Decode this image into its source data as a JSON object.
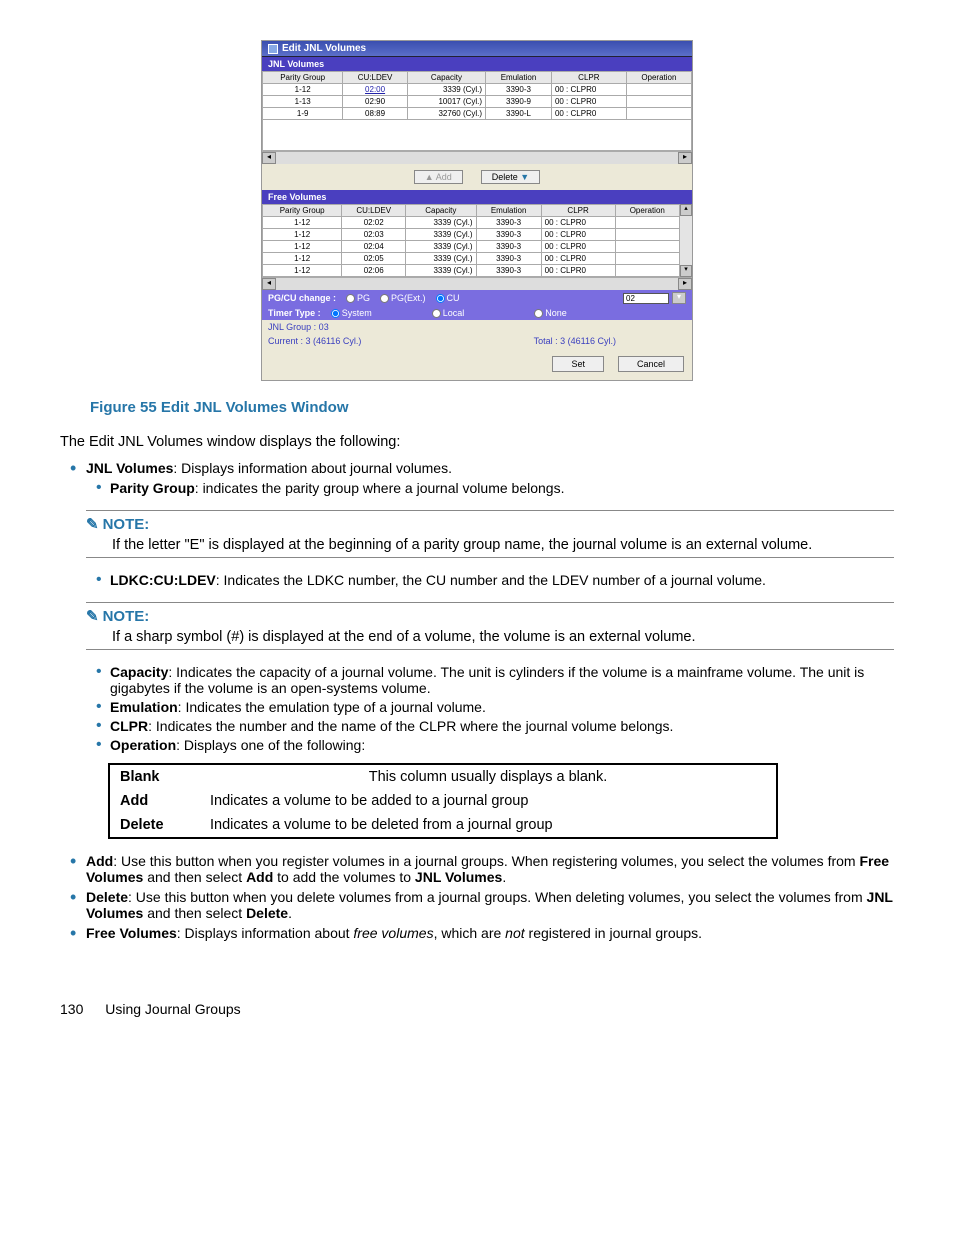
{
  "window": {
    "title": "Edit JNL Volumes",
    "jnl_section": "JNL Volumes",
    "free_section": "Free Volumes",
    "headers": [
      "Parity Group",
      "CU:LDEV",
      "Capacity",
      "Emulation",
      "CLPR",
      "Operation"
    ],
    "jnl_rows": [
      {
        "pg": "1-12",
        "cl": "02:00",
        "cap": "3339 (Cyl.)",
        "emu": "3390-3",
        "clpr": "00 : CLPR0",
        "op": ""
      },
      {
        "pg": "1-13",
        "cl": "02:90",
        "cap": "10017 (Cyl.)",
        "emu": "3390-9",
        "clpr": "00 : CLPR0",
        "op": ""
      },
      {
        "pg": "1-9",
        "cl": "08:89",
        "cap": "32760 (Cyl.)",
        "emu": "3390-L",
        "clpr": "00 : CLPR0",
        "op": ""
      }
    ],
    "free_rows": [
      {
        "pg": "1-12",
        "cl": "02:02",
        "cap": "3339 (Cyl.)",
        "emu": "3390-3",
        "clpr": "00 : CLPR0",
        "op": ""
      },
      {
        "pg": "1-12",
        "cl": "02:03",
        "cap": "3339 (Cyl.)",
        "emu": "3390-3",
        "clpr": "00 : CLPR0",
        "op": ""
      },
      {
        "pg": "1-12",
        "cl": "02:04",
        "cap": "3339 (Cyl.)",
        "emu": "3390-3",
        "clpr": "00 : CLPR0",
        "op": ""
      },
      {
        "pg": "1-12",
        "cl": "02:05",
        "cap": "3339 (Cyl.)",
        "emu": "3390-3",
        "clpr": "00 : CLPR0",
        "op": ""
      },
      {
        "pg": "1-12",
        "cl": "02:06",
        "cap": "3339 (Cyl.)",
        "emu": "3390-3",
        "clpr": "00 : CLPR0",
        "op": ""
      }
    ],
    "add_btn": "Add",
    "delete_btn": "Delete",
    "pgcu_label": "PG/CU change :",
    "pgcu_opts": [
      "PG",
      "PG(Ext.)",
      "CU"
    ],
    "pgcu_select": "02",
    "timer_label": "Timer Type :",
    "timer_opts": [
      "System",
      "Local",
      "None"
    ],
    "jnl_group": "JNL Group : 03",
    "current": "Current : 3 (46116 Cyl.)",
    "total": "Total : 3 (46116 Cyl.)",
    "set_btn": "Set",
    "cancel_btn": "Cancel"
  },
  "caption": "Figure 55 Edit JNL Volumes Window",
  "intro": "The Edit JNL Volumes window displays the following:",
  "b1": {
    "head": "JNL Volumes",
    "tail": ": Displays information about journal volumes.",
    "sub_head": "Parity Group",
    "sub_tail": ": indicates the parity group where a journal volume belongs."
  },
  "note1": {
    "title": "NOTE:",
    "body": "If the letter \"E\" is displayed at the beginning of a parity group name, the journal volume is an external volume."
  },
  "ldkc": {
    "head": "LDKC:CU:LDEV",
    "tail": ": Indicates the LDKC number, the CU number and the LDEV number of a journal volume."
  },
  "note2": {
    "title": "NOTE:",
    "body": "If a sharp symbol (#) is displayed at the end of a volume, the volume is an external volume."
  },
  "cap": {
    "head": "Capacity",
    "tail": ": Indicates the capacity of a journal volume. The unit is cylinders if the volume is a mainframe volume. The unit is gigabytes if the volume is an open-systems volume."
  },
  "emu": {
    "head": "Emulation",
    "tail": ": Indicates the emulation type of a journal volume."
  },
  "clpr": {
    "head": "CLPR",
    "tail": ": Indicates the number and the name of the CLPR where the journal volume belongs."
  },
  "op": {
    "head": "Operation",
    "tail": ": Displays one of the following:"
  },
  "op_table": {
    "r1": [
      "Blank",
      "This column usually displays a blank."
    ],
    "r2": [
      "Add",
      "Indicates a volume to be added to a journal group"
    ],
    "r3": [
      "Delete",
      "Indicates a volume to be deleted from a journal group"
    ]
  },
  "add": {
    "head": "Add",
    "p1": ": Use this button when you register volumes in a journal groups. When registering volumes, you select the volumes from ",
    "b1": "Free Volumes",
    "p2": " and then select ",
    "b2": "Add",
    "p3": " to add the volumes to ",
    "b3": "JNL Volumes",
    "p4": "."
  },
  "del": {
    "head": "Delete",
    "p1": ": Use this button when you delete volumes from a journal groups. When deleting volumes, you select the volumes from ",
    "b1": "JNL Volumes",
    "p2": " and then select ",
    "b2": "Delete",
    "p3": "."
  },
  "free": {
    "head": "Free Volumes",
    "p1": ": Displays information about ",
    "i1": "free volumes",
    "p2": ", which are ",
    "i2": "not",
    "p3": " registered in journal groups."
  },
  "footer": {
    "page": "130",
    "section": "Using Journal Groups"
  }
}
